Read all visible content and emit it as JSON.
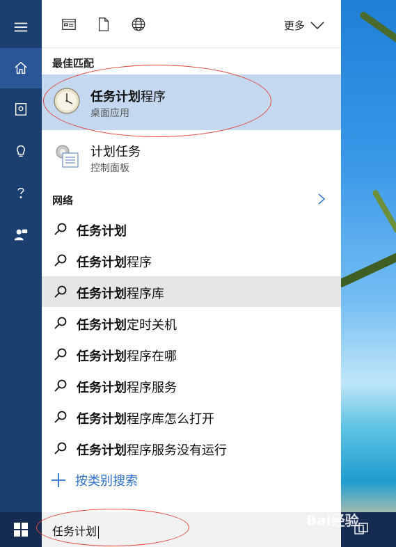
{
  "colors": {
    "rail_bg": "#1c3f72",
    "rail_active": "#2a5597",
    "selected_bg": "#c4d8ef",
    "hover_bg": "#e6e6e6",
    "accent": "#2a6fc9",
    "annotation": "#e2463c"
  },
  "rail": {
    "items": [
      {
        "icon": "hamburger-menu-icon"
      },
      {
        "icon": "home-icon",
        "active": true
      },
      {
        "icon": "notebook-icon"
      },
      {
        "icon": "lightbulb-icon"
      },
      {
        "icon": "help-icon"
      },
      {
        "icon": "feedback-icon"
      }
    ]
  },
  "topbar": {
    "filters": [
      {
        "icon": "apps-icon"
      },
      {
        "icon": "document-icon"
      },
      {
        "icon": "globe-icon"
      }
    ],
    "more_label": "更多"
  },
  "best_match": {
    "header": "最佳匹配",
    "title_bold": "任务计划",
    "title_rest": "程序",
    "subtitle": "桌面应用"
  },
  "second_result": {
    "title": "计划任务",
    "subtitle": "控制面板"
  },
  "web": {
    "header": "网络",
    "suggestions": [
      {
        "bold": "任务计划",
        "rest": ""
      },
      {
        "bold": "任务计划",
        "rest": "程序"
      },
      {
        "bold": "任务计划",
        "rest": "程序库"
      },
      {
        "bold": "任务计划",
        "rest": "定时关机"
      },
      {
        "bold": "任务计划",
        "rest": "程序在哪"
      },
      {
        "bold": "任务计划",
        "rest": "程序服务"
      },
      {
        "bold": "任务计划",
        "rest": "程序库怎么打开"
      },
      {
        "bold": "任务计划",
        "rest": "程序服务没有运行"
      }
    ]
  },
  "category_search_label": "按类别搜索",
  "taskbar": {
    "search_value": "任务计划"
  },
  "watermark": "Bai经验"
}
